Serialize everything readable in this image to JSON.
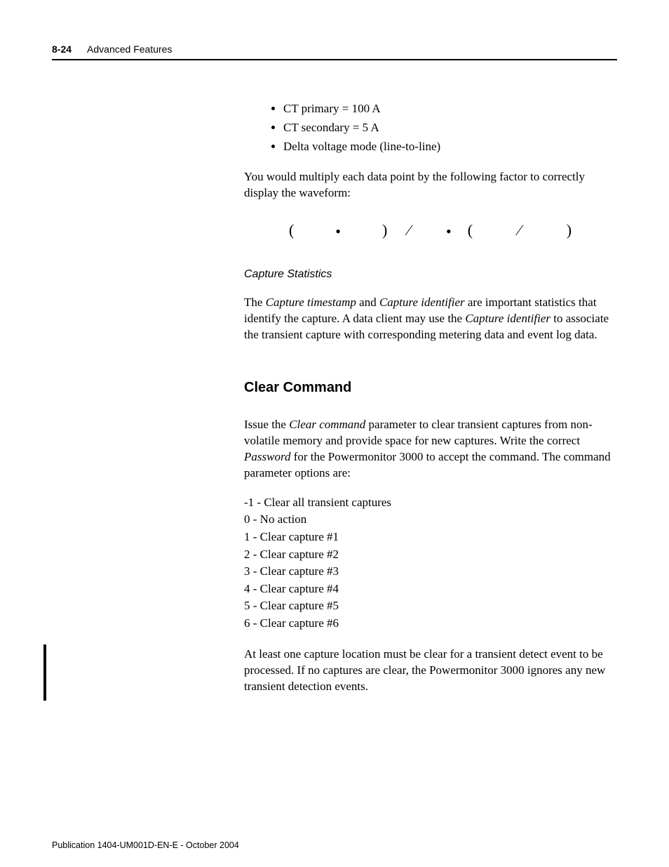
{
  "header": {
    "page_number": "8-24",
    "chapter_title": "Advanced Features"
  },
  "bullets": [
    "CT primary = 100 A",
    "CT secondary = 5 A",
    "Delta voltage mode (line-to-line)"
  ],
  "para_intro": "You would multiply each data point by the following factor to correctly display the waveform:",
  "formula": {
    "lp": "(",
    "dot1": "•",
    "rp1": ")",
    "slash1": "⁄",
    "dot2": "•",
    "lp2": "(",
    "slash2": "⁄",
    "rp2": ")"
  },
  "subhead": "Capture Statistics",
  "capture_para": {
    "pre": "The ",
    "t1": "Capture timestamp",
    "mid1": " and ",
    "t2": "Capture identifier",
    "mid2": " are important statistics that identify the capture. A data client may use the ",
    "t3": "Capture identifier",
    "post": " to associate the transient capture with corresponding metering data and event log data."
  },
  "section_title": "Clear Command",
  "clear_para": {
    "pre": "Issue the ",
    "t1": "Clear command",
    "mid1": " parameter to clear transient captures from non-volatile memory and provide space for new captures. Write the correct ",
    "t2": "Password",
    "post": " for the Powermonitor 3000 to accept the command. The command parameter options are:"
  },
  "options": [
    "-1 - Clear all transient captures",
    "0 - No action",
    "1 - Clear capture #1",
    "2 - Clear capture #2",
    "3 - Clear capture #3",
    "4 - Clear capture #4",
    "5 - Clear capture #5",
    "6 - Clear capture #6"
  ],
  "final_para": "At least one capture location must be clear for a transient detect event to be processed. If no captures are clear, the Powermonitor 3000 ignores any new transient detection events.",
  "footer": "Publication 1404-UM001D-EN-E - October 2004"
}
